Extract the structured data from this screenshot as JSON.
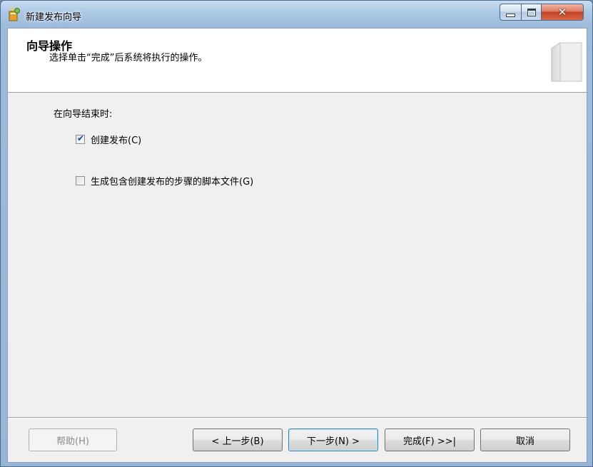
{
  "window": {
    "title": "新建发布向导",
    "icon": "wizard-app-icon",
    "controls": {
      "minimize": "minimize-icon",
      "maximize": "maximize-icon",
      "close": "close-icon"
    }
  },
  "header": {
    "title": "向导操作",
    "description": "选择单击“完成”后系统将执行的操作。",
    "graphic": "wizard-book-graphic"
  },
  "body": {
    "label": "在向导结束时:",
    "options": [
      {
        "label": "创建发布(C)",
        "checked": true
      },
      {
        "label": "生成包含创建发布的步骤的脚本文件(G)",
        "checked": false
      }
    ]
  },
  "buttons": {
    "help": "帮助(H)",
    "prev": "< 上一步(B)",
    "next": "下一步(N) >",
    "finish": "完成(F) >>|",
    "cancel": "取消"
  },
  "colors": {
    "titlebar": "#a9c6e4",
    "client": "#f0f0f0",
    "check": "#21409a",
    "close_button": "#c33f22"
  }
}
